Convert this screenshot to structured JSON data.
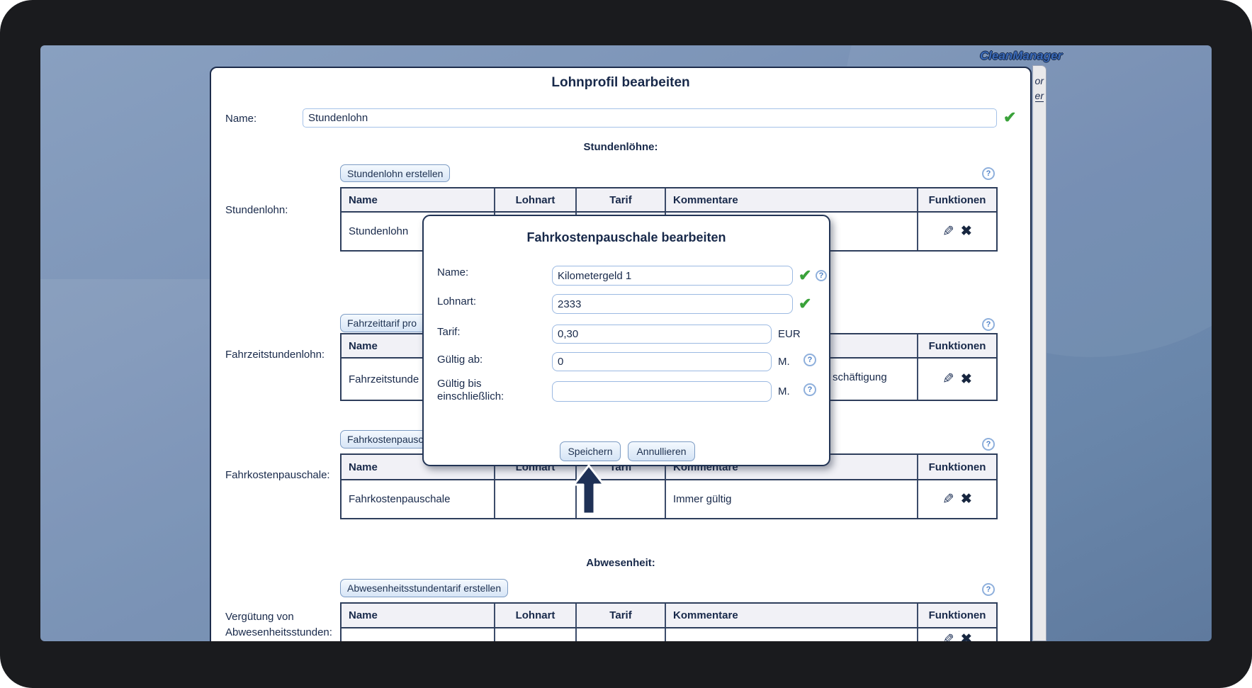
{
  "window": {
    "logo": "CleanManager",
    "side_links": {
      "link1": "or",
      "link2": "er"
    }
  },
  "page": {
    "title": "Lohnprofil bearbeiten",
    "name_label": "Name:",
    "name_value": "Stundenlohn"
  },
  "table_headers": [
    "Name",
    "Lohnart",
    "Tarif",
    "Kommentare",
    "Funktionen"
  ],
  "sections": {
    "stundenlohn": {
      "heading": "Stundenlöhne:",
      "create_button": "Stundenlohn erstellen",
      "label": "Stundenlohn:",
      "row": {
        "name": "Stundenlohn",
        "lohnart": "",
        "tarif": "",
        "kommentar": ""
      }
    },
    "fahrzeit": {
      "create_button": "Fahrzeittarif pro",
      "label": "Fahrzeitstundenlohn:",
      "row": {
        "name": "Fahrzeitstunde",
        "kommentar_fragment": "schäftigung"
      }
    },
    "fahrkosten": {
      "create_button": "Fahrkostenpausc",
      "label": "Fahrkostenpauschale:",
      "row": {
        "name": "Fahrkostenpauschale",
        "lohnart": "",
        "tarif": "",
        "kommentar": "Immer gültig"
      }
    },
    "abwesenheit": {
      "heading": "Abwesenheit:",
      "create_button": "Abwesenheitsstundentarif erstellen",
      "label_line1": "Vergütung von",
      "label_line2": "Abwesenheitsstunden:"
    }
  },
  "modal": {
    "title": "Fahrkostenpauschale bearbeiten",
    "fields": {
      "name": {
        "label": "Name:",
        "value": "Kilometergeld 1"
      },
      "lohnart": {
        "label": "Lohnart:",
        "value": "2333"
      },
      "tarif": {
        "label": "Tarif:",
        "value": "0,30",
        "unit": "EUR"
      },
      "gueltig_ab": {
        "label": "Gültig ab:",
        "value": "0",
        "unit": "M."
      },
      "gueltig_bis": {
        "label_line1": "Gültig bis",
        "label_line2": "einschließlich:",
        "value": "",
        "unit": "M."
      }
    },
    "save_button": "Speichern",
    "cancel_button": "Annullieren"
  },
  "icons": {
    "help": "?",
    "valid_check": "✔",
    "edit": "✎",
    "delete": "✖"
  },
  "colors": {
    "navy_text": "#18294a",
    "valid_green": "#3aa23a",
    "page_blue": "#7390b4",
    "table_border": "#2e3e5c",
    "input_border": "#9bb9e2",
    "logo_blue": "#3b6ab8"
  }
}
